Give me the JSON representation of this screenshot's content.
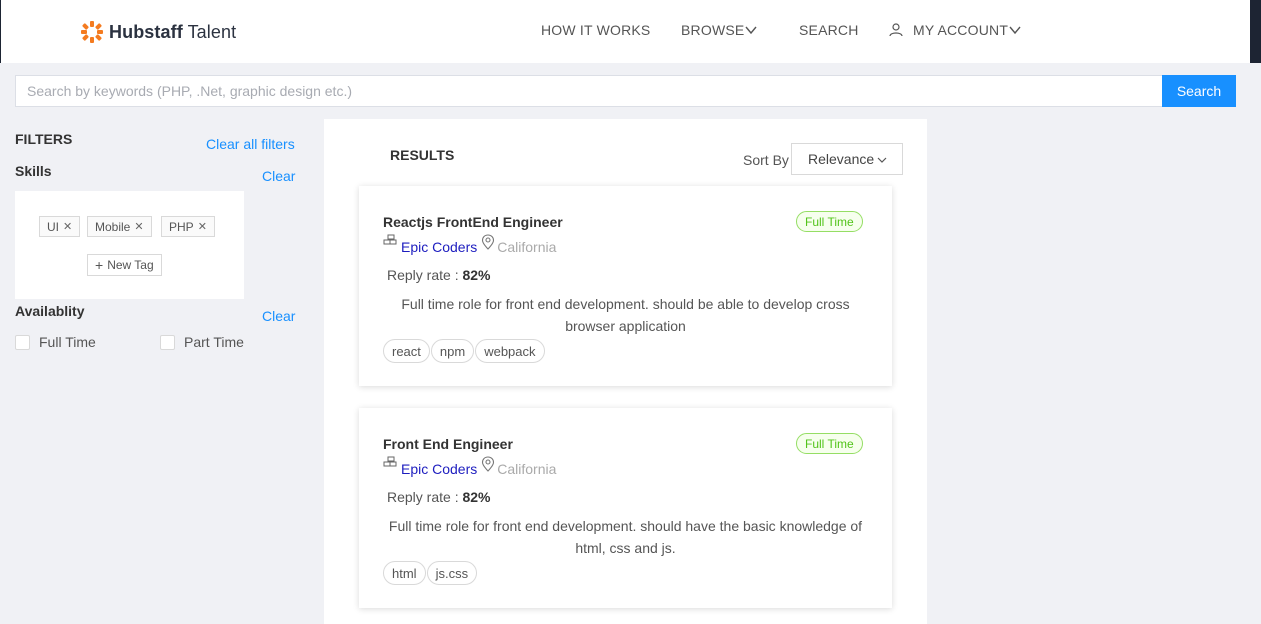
{
  "header": {
    "logo_bold": "Hubstaff",
    "logo_light": "Talent",
    "nav": {
      "how_it_works": "HOW IT WORKS",
      "browse": "BROWSE",
      "search": "SEARCH",
      "account": "MY ACCOUNT"
    }
  },
  "search": {
    "placeholder": "Search by keywords (PHP, .Net, graphic design etc.)",
    "button": "Search"
  },
  "filters": {
    "title": "FILTERS",
    "clear_all": "Clear all filters",
    "skills": {
      "title": "Skills",
      "clear": "Clear",
      "tags": [
        "UI",
        "Mobile",
        "PHP"
      ],
      "new_tag": "New Tag"
    },
    "availability": {
      "title": "Availablity",
      "clear": "Clear",
      "options": [
        "Full Time",
        "Part Time"
      ]
    }
  },
  "results": {
    "title": "RESULTS",
    "sort_label": "Sort By",
    "sort_value": "Relevance",
    "jobs": [
      {
        "title": "Reactjs FrontEnd Engineer",
        "type": "Full Time",
        "company": "Epic Coders",
        "location": "California",
        "reply_label": "Reply rate :",
        "reply_value": "82%",
        "description": "Full time role for front end development. should be able to develop cross browser application",
        "skills": [
          "react",
          "npm",
          "webpack"
        ]
      },
      {
        "title": "Front End Engineer",
        "type": "Full Time",
        "company": "Epic Coders",
        "location": "California",
        "reply_label": "Reply rate :",
        "reply_value": "82%",
        "description": "Full time role for front end development. should have the basic knowledge of html, css and js.",
        "skills": [
          "html",
          "js.css"
        ]
      }
    ]
  },
  "colors": {
    "primary": "#1890ff",
    "logo_orange": "#f47b20",
    "badge_green": "#52c41a",
    "company_link": "#1d1dbf",
    "dark_strip": "#1d2433"
  }
}
